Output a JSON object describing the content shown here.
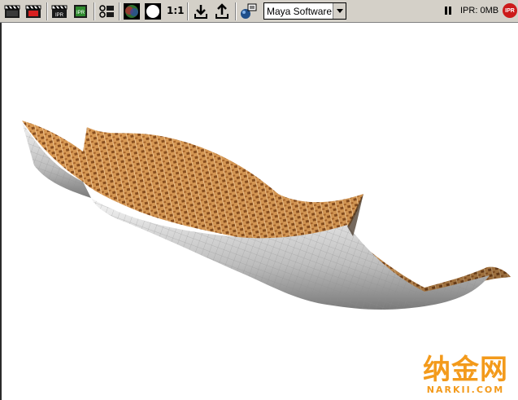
{
  "toolbar": {
    "ratio_label": "1:1",
    "renderer": "Maya Software",
    "ipr_status": "IPR: 0MB",
    "ipr_stop_label": "IPR"
  },
  "viewport": {
    "watermark_cn": "纳金网",
    "watermark_en": "NARKII.COM"
  }
}
